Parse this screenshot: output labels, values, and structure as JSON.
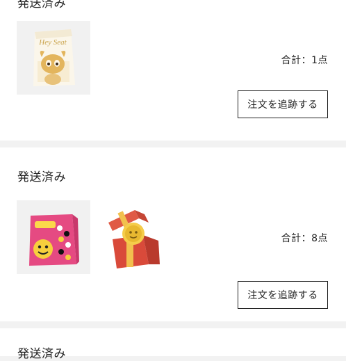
{
  "orders": [
    {
      "status": "発送済み",
      "total": "合計：1点",
      "track_label": "注文を追跡する",
      "box_text": "Hey Seat"
    },
    {
      "status": "発送済み",
      "total": "合計：8点",
      "track_label": "注文を追跡する"
    },
    {
      "status": "発送済み"
    }
  ]
}
